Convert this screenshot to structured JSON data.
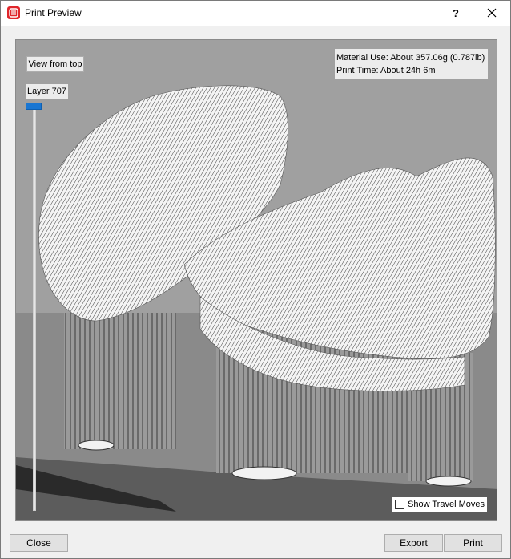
{
  "window": {
    "title": "Print Preview",
    "help_label": "?"
  },
  "viewport": {
    "view_from_top_label": "View from top",
    "layer_label": "Layer 707",
    "material_use": "Material Use: About 357.06g (0.787lb)",
    "print_time": "Print Time: About 24h 6m",
    "show_travel_moves_label": "Show Travel Moves",
    "show_travel_moves_checked": false
  },
  "footer": {
    "close_label": "Close",
    "export_label": "Export",
    "print_label": "Print"
  },
  "colors": {
    "accent": "#1976d2",
    "brand": "#e0262b",
    "viewport_bg": "#a0a0a0"
  },
  "icons": {
    "app": "makerbot-logo-icon",
    "close": "close-icon"
  }
}
